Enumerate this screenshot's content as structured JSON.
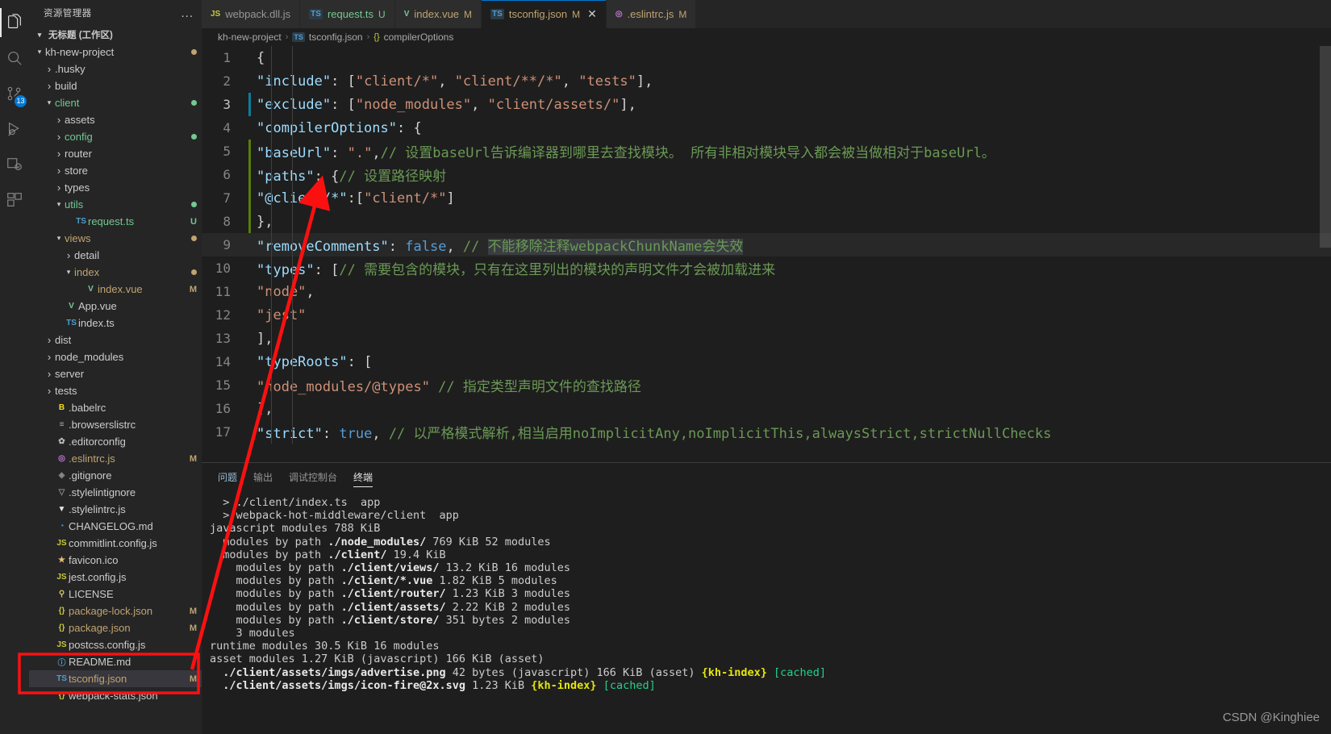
{
  "activitybar": {
    "items": [
      {
        "name": "explorer",
        "icon": "files-icon",
        "active": true,
        "badge": null
      },
      {
        "name": "search",
        "icon": "search-icon",
        "active": false,
        "badge": null
      },
      {
        "name": "source-control",
        "icon": "source-control-icon",
        "active": false,
        "badge": "13"
      },
      {
        "name": "run-debug",
        "icon": "run-debug-icon",
        "active": false,
        "badge": null
      },
      {
        "name": "testing",
        "icon": "testing-icon",
        "active": false,
        "badge": null
      },
      {
        "name": "extensions",
        "icon": "extensions-icon",
        "active": false,
        "badge": null
      }
    ]
  },
  "sidebar": {
    "title": "资源管理器",
    "more_label": "...",
    "workspace": "无标题 (工作区)",
    "tree": [
      {
        "label": "kh-new-project",
        "indent": 0,
        "twisty": "open",
        "icon": "",
        "color": "#cccccc",
        "dot": "#c0a470"
      },
      {
        "label": ".husky",
        "indent": 1,
        "twisty": "closed",
        "icon": "",
        "color": "#cccccc",
        "badge": ""
      },
      {
        "label": "build",
        "indent": 1,
        "twisty": "closed",
        "icon": "",
        "color": "#cccccc",
        "badge": ""
      },
      {
        "label": "client",
        "indent": 1,
        "twisty": "open",
        "icon": "",
        "color": "#73c991",
        "dot": "#73c991"
      },
      {
        "label": "assets",
        "indent": 2,
        "twisty": "closed",
        "icon": "",
        "color": "#cccccc",
        "badge": ""
      },
      {
        "label": "config",
        "indent": 2,
        "twisty": "closed",
        "icon": "",
        "color": "#73c991",
        "dot": "#73c991"
      },
      {
        "label": "router",
        "indent": 2,
        "twisty": "closed",
        "icon": "",
        "color": "#cccccc",
        "badge": ""
      },
      {
        "label": "store",
        "indent": 2,
        "twisty": "closed",
        "icon": "",
        "color": "#cccccc",
        "badge": ""
      },
      {
        "label": "types",
        "indent": 2,
        "twisty": "closed",
        "icon": "",
        "color": "#cccccc",
        "badge": ""
      },
      {
        "label": "utils",
        "indent": 2,
        "twisty": "open",
        "icon": "",
        "color": "#73c991",
        "dot": "#73c991"
      },
      {
        "label": "request.ts",
        "indent": 3,
        "twisty": "none",
        "icon": "TS",
        "iconcolor": "#4e9fd0",
        "color": "#73c991",
        "badge": "U",
        "badgecolor": "#73c991"
      },
      {
        "label": "views",
        "indent": 2,
        "twisty": "open",
        "icon": "",
        "color": "#c0a470",
        "dot": "#c0a470"
      },
      {
        "label": "detail",
        "indent": 3,
        "twisty": "closed",
        "icon": "",
        "color": "#cccccc",
        "badge": ""
      },
      {
        "label": "index",
        "indent": 3,
        "twisty": "open",
        "icon": "",
        "color": "#c0a470",
        "dot": "#c0a470"
      },
      {
        "label": "index.vue",
        "indent": 4,
        "twisty": "none",
        "icon": "V",
        "iconcolor": "#7ec699",
        "color": "#c0a470",
        "badge": "M",
        "badgecolor": "#c0a470"
      },
      {
        "label": "App.vue",
        "indent": 2,
        "twisty": "none",
        "icon": "V",
        "iconcolor": "#7ec699",
        "color": "#cccccc",
        "badge": ""
      },
      {
        "label": "index.ts",
        "indent": 2,
        "twisty": "none",
        "icon": "TS",
        "iconcolor": "#4e9fd0",
        "color": "#cccccc",
        "badge": ""
      },
      {
        "label": "dist",
        "indent": 1,
        "twisty": "closed",
        "icon": "",
        "color": "#cccccc",
        "badge": ""
      },
      {
        "label": "node_modules",
        "indent": 1,
        "twisty": "closed",
        "icon": "",
        "color": "#cccccc",
        "badge": ""
      },
      {
        "label": "server",
        "indent": 1,
        "twisty": "closed",
        "icon": "",
        "color": "#cccccc",
        "badge": ""
      },
      {
        "label": "tests",
        "indent": 1,
        "twisty": "closed",
        "icon": "",
        "color": "#cccccc",
        "badge": ""
      },
      {
        "label": ".babelrc",
        "indent": 1,
        "twisty": "none",
        "icon": "B",
        "iconcolor": "#f5de19",
        "color": "#cccccc",
        "badge": ""
      },
      {
        "label": ".browserslistrc",
        "indent": 1,
        "twisty": "none",
        "icon": "≡",
        "iconcolor": "#9cb8a0",
        "color": "#cccccc",
        "badge": ""
      },
      {
        "label": ".editorconfig",
        "indent": 1,
        "twisty": "none",
        "icon": "✿",
        "iconcolor": "#b7bcc0",
        "color": "#cccccc",
        "badge": ""
      },
      {
        "label": ".eslintrc.js",
        "indent": 1,
        "twisty": "none",
        "icon": "◎",
        "iconcolor": "#c678dd",
        "color": "#c0a470",
        "badge": "M",
        "badgecolor": "#c0a470"
      },
      {
        "label": ".gitignore",
        "indent": 1,
        "twisty": "none",
        "icon": "◈",
        "iconcolor": "#8a8a8a",
        "color": "#cccccc",
        "badge": ""
      },
      {
        "label": ".stylelintignore",
        "indent": 1,
        "twisty": "none",
        "icon": "▽",
        "iconcolor": "#8a8a8a",
        "color": "#cccccc",
        "badge": ""
      },
      {
        "label": ".stylelintrc.js",
        "indent": 1,
        "twisty": "none",
        "icon": "▼",
        "iconcolor": "#e7e7e7",
        "color": "#cccccc",
        "badge": ""
      },
      {
        "label": "CHANGELOG.md",
        "indent": 1,
        "twisty": "none",
        "icon": "◔",
        "iconcolor": "#4e9fd0",
        "color": "#cccccc",
        "badge": ""
      },
      {
        "label": "commitlint.config.js",
        "indent": 1,
        "twisty": "none",
        "icon": "JS",
        "iconcolor": "#c9c93a",
        "color": "#cccccc",
        "badge": ""
      },
      {
        "label": "favicon.ico",
        "indent": 1,
        "twisty": "none",
        "icon": "★",
        "iconcolor": "#e5c07b",
        "color": "#cccccc",
        "badge": ""
      },
      {
        "label": "jest.config.js",
        "indent": 1,
        "twisty": "none",
        "icon": "JS",
        "iconcolor": "#c9c93a",
        "color": "#cccccc",
        "badge": ""
      },
      {
        "label": "LICENSE",
        "indent": 1,
        "twisty": "none",
        "icon": "⚲",
        "iconcolor": "#d6cf5a",
        "color": "#cccccc",
        "badge": ""
      },
      {
        "label": "package-lock.json",
        "indent": 1,
        "twisty": "none",
        "icon": "{}",
        "iconcolor": "#c9c93a",
        "color": "#c0a470",
        "badge": "M",
        "badgecolor": "#c0a470"
      },
      {
        "label": "package.json",
        "indent": 1,
        "twisty": "none",
        "icon": "{}",
        "iconcolor": "#c9c93a",
        "color": "#c0a470",
        "badge": "M",
        "badgecolor": "#c0a470"
      },
      {
        "label": "postcss.config.js",
        "indent": 1,
        "twisty": "none",
        "icon": "JS",
        "iconcolor": "#c9c93a",
        "color": "#cccccc",
        "badge": ""
      },
      {
        "label": "README.md",
        "indent": 1,
        "twisty": "none",
        "icon": "ⓘ",
        "iconcolor": "#4e9fd0",
        "color": "#cccccc",
        "badge": ""
      },
      {
        "label": "tsconfig.json",
        "indent": 1,
        "twisty": "none",
        "icon": "TS",
        "iconcolor": "#4e9fd0",
        "color": "#c0a470",
        "badge": "M",
        "badgecolor": "#c0a470",
        "selected": true
      },
      {
        "label": "webpack-stats.json",
        "indent": 1,
        "twisty": "none",
        "icon": "{}",
        "iconcolor": "#c9c93a",
        "color": "#cccccc",
        "badge": ""
      }
    ]
  },
  "tabs": [
    {
      "icon": "JS",
      "iconcolor": "#c9c93a",
      "label": "webpack.dll.js",
      "modified": "",
      "active": false,
      "close": false
    },
    {
      "icon": "TS",
      "iconcolor": "#4e9fd0",
      "label": "request.ts",
      "modified": "U",
      "active": false,
      "close": false,
      "color": "#73c991"
    },
    {
      "icon": "V",
      "iconcolor": "#7ec699",
      "label": "index.vue",
      "modified": "M",
      "active": false,
      "close": false,
      "color": "#c0a470"
    },
    {
      "icon": "TS",
      "iconcolor": "#4e9fd0",
      "label": "tsconfig.json",
      "modified": "M",
      "active": true,
      "close": true,
      "color": "#c0a470"
    },
    {
      "icon": "◎",
      "iconcolor": "#c678dd",
      "label": ".eslintrc.js",
      "modified": "M",
      "active": false,
      "close": false,
      "color": "#c0a470"
    }
  ],
  "breadcrumb": {
    "root": "kh-new-project",
    "file_icon": "TS",
    "file": "tsconfig.json",
    "symbol_icon": "{}",
    "symbol": "compilerOptions",
    "separator": "›"
  },
  "code": {
    "lines": [
      {
        "n": "1",
        "marker": "",
        "segments": [
          {
            "t": "{",
            "c": "p"
          }
        ]
      },
      {
        "n": "2",
        "marker": "",
        "segments": [
          {
            "t": "  \"include\"",
            "c": "k"
          },
          {
            "t": ": [",
            "c": "p"
          },
          {
            "t": "\"client/*\"",
            "c": "s"
          },
          {
            "t": ", ",
            "c": "p"
          },
          {
            "t": "\"client/**/*\"",
            "c": "s"
          },
          {
            "t": ", ",
            "c": "p"
          },
          {
            "t": "\"tests\"",
            "c": "s"
          },
          {
            "t": "],",
            "c": "p"
          }
        ]
      },
      {
        "n": "3",
        "marker": "blue",
        "segments": [
          {
            "t": "  \"exclude\"",
            "c": "k"
          },
          {
            "t": ": [",
            "c": "p"
          },
          {
            "t": "\"node_modules\"",
            "c": "s"
          },
          {
            "t": ", ",
            "c": "p"
          },
          {
            "t": "\"client/assets/\"",
            "c": "s"
          },
          {
            "t": "],",
            "c": "p"
          }
        ]
      },
      {
        "n": "4",
        "marker": "",
        "segments": [
          {
            "t": "  \"compilerOptions\"",
            "c": "k"
          },
          {
            "t": ": {",
            "c": "p"
          }
        ]
      },
      {
        "n": "5",
        "marker": "green",
        "segments": [
          {
            "t": "    \"baseUrl\"",
            "c": "k"
          },
          {
            "t": ": ",
            "c": "p"
          },
          {
            "t": "\".\"",
            "c": "s"
          },
          {
            "t": ",",
            "c": "p"
          },
          {
            "t": "// 设置baseUrl告诉编译器到哪里去查找模块。 所有非相对模块导入都会被当做相对于baseUrl。",
            "c": "c"
          }
        ]
      },
      {
        "n": "6",
        "marker": "green",
        "segments": [
          {
            "t": "    \"paths\"",
            "c": "k"
          },
          {
            "t": ": {",
            "c": "p"
          },
          {
            "t": "// 设置路径映射",
            "c": "c"
          }
        ]
      },
      {
        "n": "7",
        "marker": "green",
        "segments": [
          {
            "t": "      \"@client/*\"",
            "c": "k"
          },
          {
            "t": ":[",
            "c": "p"
          },
          {
            "t": "\"client/*\"",
            "c": "s"
          },
          {
            "t": "]",
            "c": "p"
          }
        ]
      },
      {
        "n": "8",
        "marker": "green",
        "segments": [
          {
            "t": "    },",
            "c": "p"
          }
        ]
      },
      {
        "n": "9",
        "marker": "",
        "highlight": true,
        "segments": [
          {
            "t": "    \"removeComments\"",
            "c": "k"
          },
          {
            "t": ": ",
            "c": "p"
          },
          {
            "t": "false",
            "c": "b"
          },
          {
            "t": ", ",
            "c": "p"
          },
          {
            "t": "// ",
            "c": "c"
          },
          {
            "t": "不能移除注释webpackChunkName会失效",
            "c": "c",
            "find": true
          }
        ]
      },
      {
        "n": "10",
        "marker": "",
        "segments": [
          {
            "t": "    \"types\"",
            "c": "k"
          },
          {
            "t": ": [",
            "c": "p"
          },
          {
            "t": "// 需要包含的模块，只有在这里列出的模块的声明文件才会被加载进来",
            "c": "c"
          }
        ]
      },
      {
        "n": "11",
        "marker": "",
        "segments": [
          {
            "t": "      ",
            "c": "p"
          },
          {
            "t": "\"node\"",
            "c": "s"
          },
          {
            "t": ",",
            "c": "p"
          }
        ]
      },
      {
        "n": "12",
        "marker": "",
        "segments": [
          {
            "t": "      ",
            "c": "p"
          },
          {
            "t": "\"jest\"",
            "c": "s"
          }
        ]
      },
      {
        "n": "13",
        "marker": "",
        "segments": [
          {
            "t": "    ],",
            "c": "p"
          }
        ]
      },
      {
        "n": "14",
        "marker": "",
        "segments": [
          {
            "t": "    \"typeRoots\"",
            "c": "k"
          },
          {
            "t": ": [",
            "c": "p"
          }
        ]
      },
      {
        "n": "15",
        "marker": "",
        "segments": [
          {
            "t": "      ",
            "c": "p"
          },
          {
            "t": "\"node_modules/@types\"",
            "c": "s"
          },
          {
            "t": " // 指定类型声明文件的查找路径",
            "c": "c"
          }
        ]
      },
      {
        "n": "16",
        "marker": "",
        "segments": [
          {
            "t": "    ],",
            "c": "p"
          }
        ]
      },
      {
        "n": "17",
        "marker": "",
        "segments": [
          {
            "t": "    \"strict\"",
            "c": "k"
          },
          {
            "t": ": ",
            "c": "p"
          },
          {
            "t": "true",
            "c": "b"
          },
          {
            "t": ", ",
            "c": "p"
          },
          {
            "t": "// 以严格模式解析,相当启用noImplicitAny,noImplicitThis,alwaysStrict,strictNullChecks",
            "c": "c"
          }
        ]
      }
    ]
  },
  "panel": {
    "tabs": [
      {
        "label": "问题",
        "active": false,
        "problems": true
      },
      {
        "label": "输出",
        "active": false
      },
      {
        "label": "调试控制台",
        "active": false
      },
      {
        "label": "终端",
        "active": true
      }
    ],
    "terminal_lines": [
      [
        {
          "t": "  ",
          "c": "p"
        },
        {
          "t": "> ",
          "c": "arrow"
        },
        {
          "t": "./client/index.ts  app",
          "c": "p"
        }
      ],
      [
        {
          "t": "  ",
          "c": "p"
        },
        {
          "t": "> ",
          "c": "arrow"
        },
        {
          "t": "webpack-hot-middleware/client  app",
          "c": "p"
        }
      ],
      [
        {
          "t": "javascript modules 788 KiB",
          "c": "p"
        }
      ],
      [
        {
          "t": "  modules by path ",
          "c": "p"
        },
        {
          "t": "./node_modules/",
          "c": "b"
        },
        {
          "t": " 769 KiB 52 modules",
          "c": "p"
        }
      ],
      [
        {
          "t": "  modules by path ",
          "c": "p"
        },
        {
          "t": "./client/",
          "c": "b"
        },
        {
          "t": " 19.4 KiB",
          "c": "p"
        }
      ],
      [
        {
          "t": "    modules by path ",
          "c": "p"
        },
        {
          "t": "./client/views/",
          "c": "b"
        },
        {
          "t": " 13.2 KiB 16 modules",
          "c": "p"
        }
      ],
      [
        {
          "t": "    modules by path ",
          "c": "p"
        },
        {
          "t": "./client/*.vue",
          "c": "b"
        },
        {
          "t": " 1.82 KiB 5 modules",
          "c": "p"
        }
      ],
      [
        {
          "t": "    modules by path ",
          "c": "p"
        },
        {
          "t": "./client/router/",
          "c": "b"
        },
        {
          "t": " 1.23 KiB 3 modules",
          "c": "p"
        }
      ],
      [
        {
          "t": "    modules by path ",
          "c": "p"
        },
        {
          "t": "./client/assets/",
          "c": "b"
        },
        {
          "t": " 2.22 KiB 2 modules",
          "c": "p"
        }
      ],
      [
        {
          "t": "    modules by path ",
          "c": "p"
        },
        {
          "t": "./client/store/",
          "c": "b"
        },
        {
          "t": " 351 bytes 2 modules",
          "c": "p"
        }
      ],
      [
        {
          "t": "    3 modules",
          "c": "p"
        }
      ],
      [
        {
          "t": "runtime modules 30.5 KiB 16 modules",
          "c": "p"
        }
      ],
      [
        {
          "t": "asset modules 1.27 KiB (javascript) 166 KiB (asset)",
          "c": "p"
        }
      ],
      [
        {
          "t": "  ",
          "c": "p"
        },
        {
          "t": "./client/assets/imgs/advertise.png",
          "c": "b"
        },
        {
          "t": " 42 bytes (javascript) 166 KiB (asset) ",
          "c": "p"
        },
        {
          "t": "{kh-index}",
          "c": "y"
        },
        {
          "t": " ",
          "c": "p"
        },
        {
          "t": "[cached]",
          "c": "g"
        }
      ],
      [
        {
          "t": "  ",
          "c": "p"
        },
        {
          "t": "./client/assets/imgs/icon-fire@2x.svg",
          "c": "b"
        },
        {
          "t": " 1.23 KiB ",
          "c": "p"
        },
        {
          "t": "{kh-index}",
          "c": "y"
        },
        {
          "t": " ",
          "c": "p"
        },
        {
          "t": "[cached]",
          "c": "g"
        }
      ]
    ]
  },
  "annotations": {
    "arrow_color": "#fb1010",
    "box_color": "#fb1010",
    "watermark": "CSDN @Kinghiee"
  }
}
